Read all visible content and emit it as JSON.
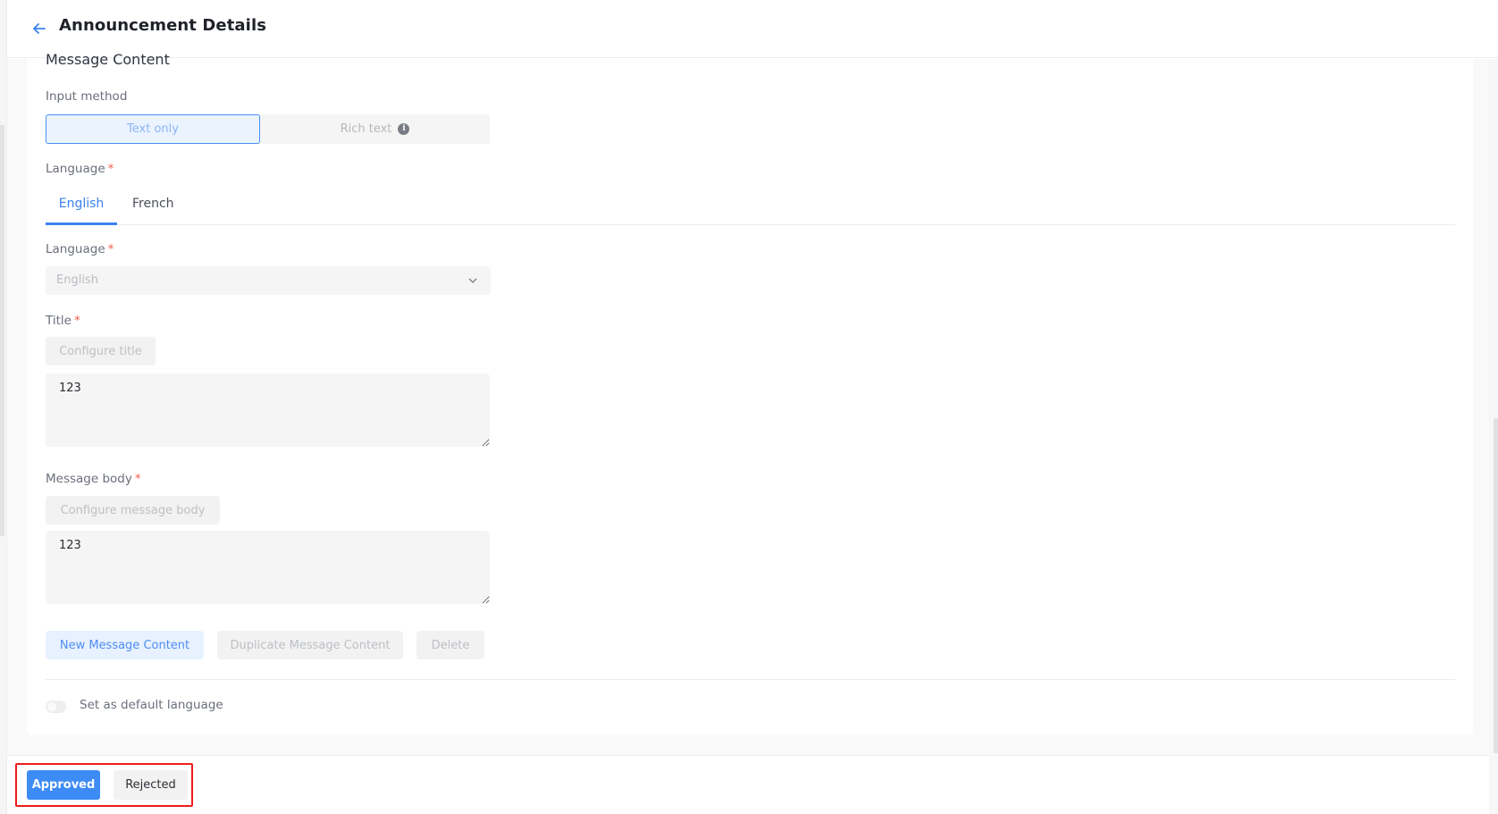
{
  "header": {
    "back_icon": "arrow-left-icon",
    "title": "Announcement Details"
  },
  "section": {
    "title": "Message Content"
  },
  "input_method": {
    "label": "Input method",
    "options": [
      {
        "label": "Text only",
        "selected": true
      },
      {
        "label": "Rich text",
        "selected": false,
        "icon": "info-icon"
      }
    ]
  },
  "language_tabs": {
    "label": "Language",
    "required_mark": "*",
    "tabs": [
      {
        "label": "English",
        "active": true
      },
      {
        "label": "French",
        "active": false
      }
    ]
  },
  "language_select": {
    "label": "Language",
    "required_mark": "*",
    "value": "English"
  },
  "title_field": {
    "label": "Title",
    "required_mark": "*",
    "configure_button": "Configure title",
    "value": "123"
  },
  "body_field": {
    "label": "Message body",
    "required_mark": "*",
    "configure_button": "Configure message body",
    "value": "123"
  },
  "actions": {
    "new": "New Message Content",
    "duplicate": "Duplicate Message Content",
    "delete": "Delete"
  },
  "default_language": {
    "label": "Set as default language",
    "enabled": false
  },
  "footer": {
    "approve": "Approved",
    "reject": "Rejected"
  },
  "colors": {
    "accent": "#3d8bf5",
    "required": "#f5614f",
    "highlight": "#ee1c1c"
  }
}
